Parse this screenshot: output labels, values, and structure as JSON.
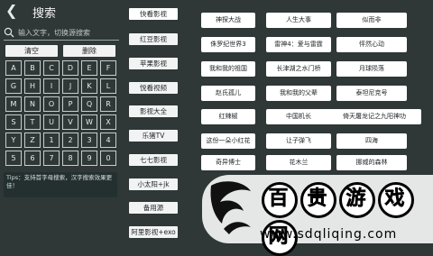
{
  "header": {
    "title": "搜索"
  },
  "search": {
    "placeholder": "输入文字，切换源搜索"
  },
  "actions": {
    "clear_label": "清空",
    "delete_label": "删除"
  },
  "keyboard": {
    "keys": [
      "A",
      "B",
      "C",
      "D",
      "E",
      "F",
      "G",
      "H",
      "I",
      "J",
      "K",
      "L",
      "M",
      "N",
      "O",
      "P",
      "Q",
      "R",
      "S",
      "T",
      "U",
      "V",
      "W",
      "X",
      "Y",
      "Z",
      "1",
      "2",
      "3",
      "4",
      "5",
      "6",
      "7",
      "8",
      "9",
      "0"
    ]
  },
  "tips": {
    "text": "Tips：支持首字母搜索，汉字搜索效果更佳！"
  },
  "sources": [
    {
      "label": "快看影视",
      "selected": true
    },
    {
      "label": "红豆影视"
    },
    {
      "label": "苹果影视"
    },
    {
      "label": "悦看视频"
    },
    {
      "label": "影视大全"
    },
    {
      "label": "乐猪TV"
    },
    {
      "label": "七七影视"
    },
    {
      "label": "小太阳+jk"
    },
    {
      "label": "备用源"
    },
    {
      "label": "阿里影视+exo"
    }
  ],
  "results": [
    [
      "神探大战",
      "人生大事",
      "似而非"
    ],
    [
      "侏罗纪世界3",
      "雷神4：爱与雷霆",
      "怦然心动"
    ],
    [
      "我和我的祖国",
      "长津湖之水门桥",
      "月球陨落"
    ],
    [
      "赵氏孤儿",
      "我和我的父辈",
      "泰坦尼克号"
    ],
    [
      "红辣椒",
      "中国机长",
      "倚天屠龙记之九阳神功"
    ],
    [
      "这份一朵小红花",
      "让子弹飞",
      "四海"
    ],
    [
      "奇异博士",
      "花木兰",
      "挪威的森林"
    ]
  ],
  "watermark": {
    "text": "百贵游戏网",
    "url": "www.sdqliqing.com"
  }
}
